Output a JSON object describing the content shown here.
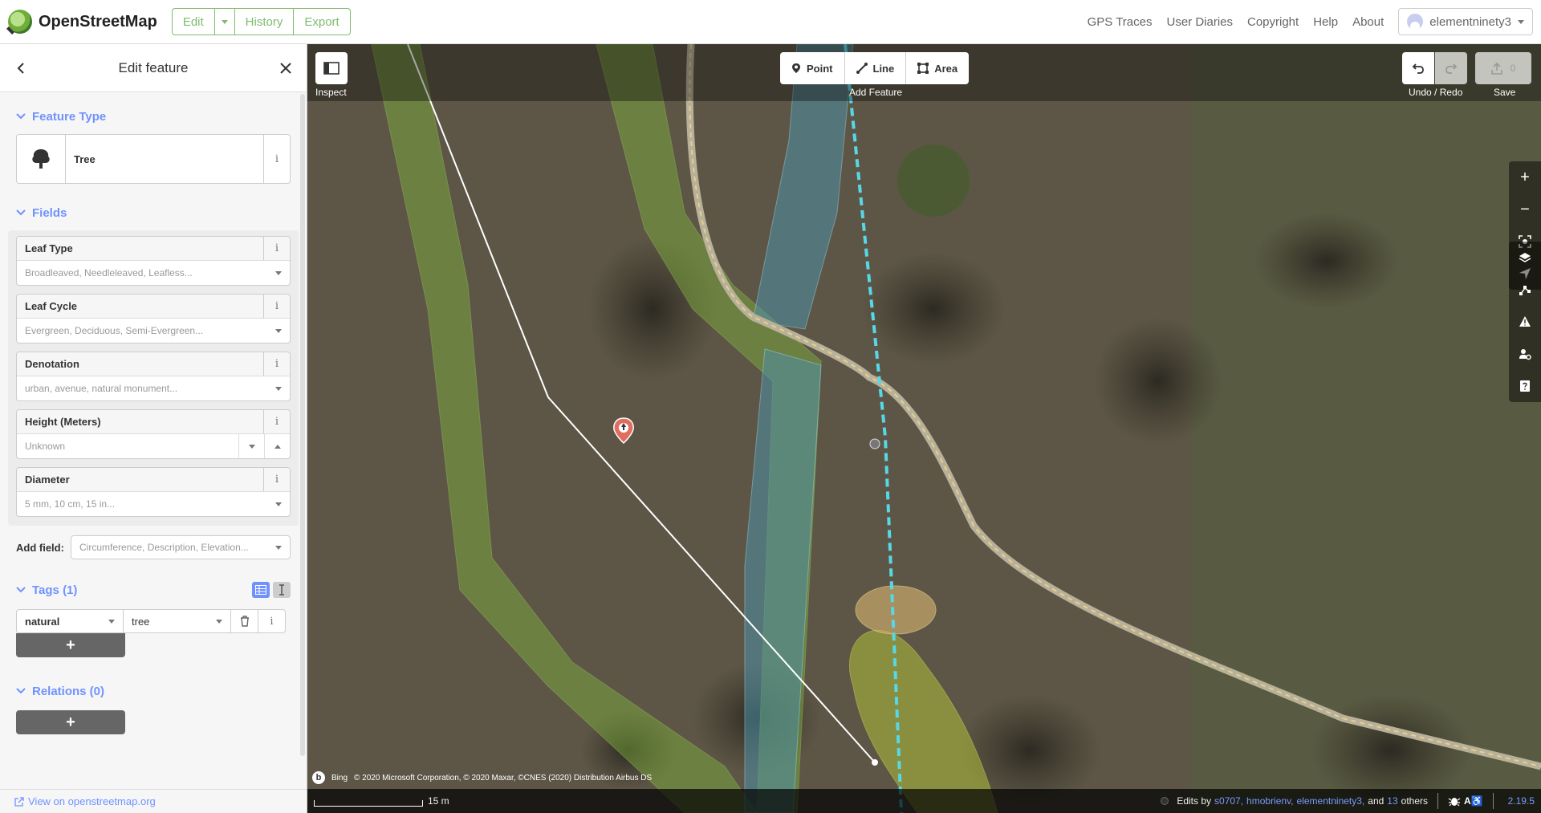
{
  "topbar": {
    "site_name": "OpenStreetMap",
    "edit_label": "Edit",
    "history_label": "History",
    "export_label": "Export",
    "nav": [
      "GPS Traces",
      "User Diaries",
      "Copyright",
      "Help",
      "About"
    ],
    "username": "elementninety3"
  },
  "sidebar": {
    "title": "Edit feature",
    "feature_type_heading": "Feature Type",
    "preset_name": "Tree",
    "fields_heading": "Fields",
    "fields": [
      {
        "label": "Leaf Type",
        "placeholder": "Broadleaved, Needleleaved, Leafless..."
      },
      {
        "label": "Leaf Cycle",
        "placeholder": "Evergreen, Deciduous, Semi-Evergreen..."
      },
      {
        "label": "Denotation",
        "placeholder": "urban, avenue, natural monument..."
      },
      {
        "label": "Height (Meters)",
        "placeholder": "Unknown"
      },
      {
        "label": "Diameter",
        "placeholder": "5 mm, 10 cm, 15 in..."
      }
    ],
    "add_field_label": "Add field:",
    "add_field_placeholder": "Circumference, Description, Elevation...",
    "tags_heading": "Tags (1)",
    "tags": [
      {
        "key": "natural",
        "value": "tree"
      }
    ],
    "relations_heading": "Relations (0)",
    "footer_link": "View on openstreetmap.org"
  },
  "map": {
    "inspect_label": "Inspect",
    "modes": [
      "Point",
      "Line",
      "Area"
    ],
    "add_feature_label": "Add Feature",
    "undo_redo_label": "Undo / Redo",
    "save_label": "Save",
    "save_count": "0",
    "imagery_provider": "Bing",
    "attribution": "© 2020 Microsoft Corporation, © 2020 Maxar, ©CNES (2020) Distribution Airbus DS",
    "scale_label": "15 m",
    "edits_by_prefix": "Edits by",
    "editors": [
      "s0707,",
      "hmobrienv,",
      "elementninety3,"
    ],
    "and_label": "and",
    "others_count": "13",
    "others_label": "others",
    "version": "2.19.5",
    "colors": {
      "accent": "#7092ff",
      "osm_green": "#7ebc6f",
      "marker": "#e06e5f"
    }
  }
}
